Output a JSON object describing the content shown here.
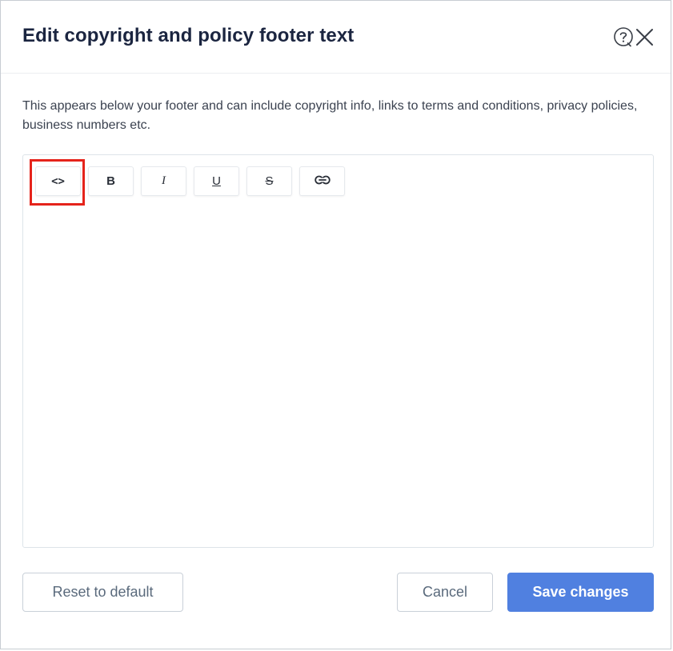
{
  "dialog": {
    "title": "Edit copyright and policy footer text",
    "description": "This appears below your footer and can include copyright info, links to terms and conditions, privacy policies, business numbers etc."
  },
  "header_icons": {
    "help": "help-icon",
    "close": "close-icon"
  },
  "toolbar": {
    "code_label": "<>",
    "bold_label": "B",
    "italic_label": "I",
    "underline_label": "U",
    "strike_label": "S",
    "link_icon": "link-icon"
  },
  "editor": {
    "content": ""
  },
  "footer": {
    "reset_label": "Reset to default",
    "cancel_label": "Cancel",
    "save_label": "Save changes"
  },
  "colors": {
    "accent": "#5080e0",
    "title": "#1b2540",
    "highlight": "#e5231b"
  }
}
